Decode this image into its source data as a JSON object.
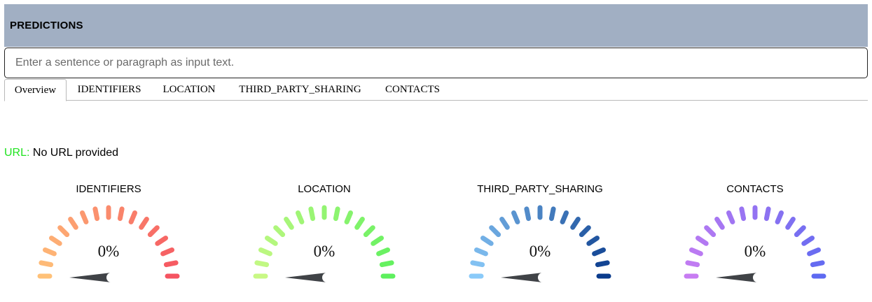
{
  "header": {
    "title": "PREDICTIONS"
  },
  "input": {
    "placeholder": "Enter a sentence or paragraph as input text.",
    "value": ""
  },
  "tabs": [
    {
      "label": "Overview",
      "active": true
    },
    {
      "label": "IDENTIFIERS",
      "active": false
    },
    {
      "label": "LOCATION",
      "active": false
    },
    {
      "label": "THIRD_PARTY_SHARING",
      "active": false
    },
    {
      "label": "CONTACTS",
      "active": false
    }
  ],
  "url": {
    "label": "URL:",
    "value": "No URL provided",
    "label_color": "#1fe31f"
  },
  "gauges": [
    {
      "title": "IDENTIFIERS",
      "value_text": "0%",
      "value": 0,
      "color_start": "#ffc178",
      "color_end": "#f55461"
    },
    {
      "title": "LOCATION",
      "value_text": "0%",
      "value": 0,
      "color_start": "#c8f885",
      "color_end": "#5ef05e"
    },
    {
      "title": "THIRD_PARTY_SHARING",
      "value_text": "0%",
      "value": 0,
      "color_start": "#8acaf9",
      "color_end": "#0a3b8c"
    },
    {
      "title": "CONTACTS",
      "value_text": "0%",
      "value": 0,
      "color_start": "#c77cf2",
      "color_end": "#5e6af1"
    }
  ],
  "colors": {
    "header_bg": "#a1afc3",
    "needle": "#404347"
  }
}
